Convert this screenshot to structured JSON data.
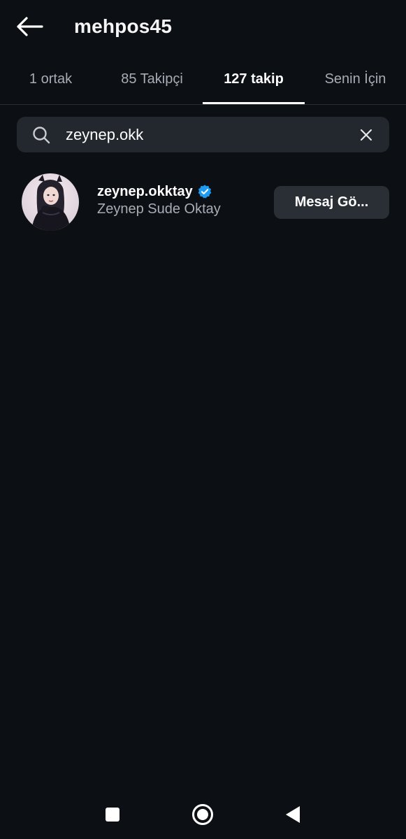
{
  "header": {
    "title": "mehpos45",
    "back_icon": "arrow-left-icon"
  },
  "tabs": [
    {
      "label": "1 ortak",
      "active": false
    },
    {
      "label": "85 Takipçi",
      "active": false
    },
    {
      "label": "127 takip",
      "active": true
    },
    {
      "label": "Senin İçin",
      "active": false
    }
  ],
  "search": {
    "value": "zeynep.okk",
    "search_icon": "search-icon",
    "clear_icon": "close-icon"
  },
  "results": [
    {
      "username": "zeynep.okktay",
      "full_name": "Zeynep Sude Oktay",
      "verified": true,
      "button_label": "Mesaj Gö..."
    }
  ],
  "navbar": {
    "items": [
      "recents-icon",
      "home-icon",
      "back-triangle-icon"
    ]
  },
  "colors": {
    "background": "#0c0f14",
    "search_bg": "#23272e",
    "button_bg": "#2a2e35",
    "verified": "#1d9bf0",
    "muted_text": "#a8adb5"
  }
}
